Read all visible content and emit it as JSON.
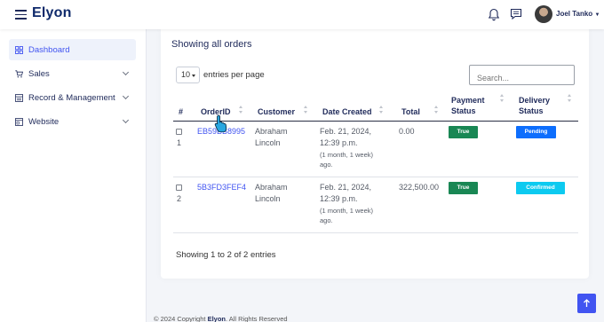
{
  "topbar": {
    "brand": "Elyon",
    "user_name": "Joel Tanko"
  },
  "icons": {
    "menu": "hamburger-icon",
    "notifications": "bell-icon",
    "messages": "chat-icon",
    "user_caret": "caret-down-icon"
  },
  "sidebar": {
    "items": [
      {
        "label": "Dashboard",
        "icon": "grid-icon",
        "active": true
      },
      {
        "label": "Sales",
        "icon": "cart-icon",
        "expandable": true
      },
      {
        "label": "Record & Management",
        "icon": "records-icon",
        "expandable": true
      },
      {
        "label": "Website",
        "icon": "website-icon",
        "expandable": true
      }
    ]
  },
  "main": {
    "title": "Showing all orders",
    "per_page_value": "10",
    "per_page_label": "entries per page",
    "search_placeholder": "Search...",
    "table": {
      "headers": {
        "num": "#",
        "order_id": "OrderID",
        "customer": "Customer",
        "date": "Date Created",
        "total": "Total",
        "payment_l1": "Payment",
        "payment_l2": "Status",
        "delivery_l1": "Delivery",
        "delivery_l2": "Status"
      },
      "rows": [
        {
          "num": "1",
          "order_id": "EB59BB8995",
          "customer_l1": "Abraham",
          "customer_l2": "Lincoln",
          "date_l1": "Feb. 21, 2024,",
          "date_l2": "12:39 p.m.",
          "ago_l1": "(1 month, 1 week)",
          "ago_l2": "ago.",
          "total": "0.00",
          "payment": "True",
          "delivery": "Pending"
        },
        {
          "num": "2",
          "order_id": "5B3FD3FEF4",
          "customer_l1": "Abraham",
          "customer_l2": "Lincoln",
          "date_l1": "Feb. 21, 2024,",
          "date_l2": "12:39 p.m.",
          "ago_l1": "(1 month, 1 week)",
          "ago_l2": "ago.",
          "total": "322,500.00",
          "payment": "True",
          "delivery": "Confirmed"
        }
      ]
    },
    "footer_info": "Showing 1 to 2 of 2 entries"
  },
  "footer": {
    "copyright_prefix": "© 2024 Copyright ",
    "copyright_brand": "Elyon",
    "copyright_suffix": ". All Rights Reserved"
  },
  "colors": {
    "accent": "#4154f1",
    "brand": "#0f2a6b",
    "badge_true": "#198754",
    "badge_pending": "#0d6efd",
    "badge_confirmed": "#0dcaf0"
  }
}
